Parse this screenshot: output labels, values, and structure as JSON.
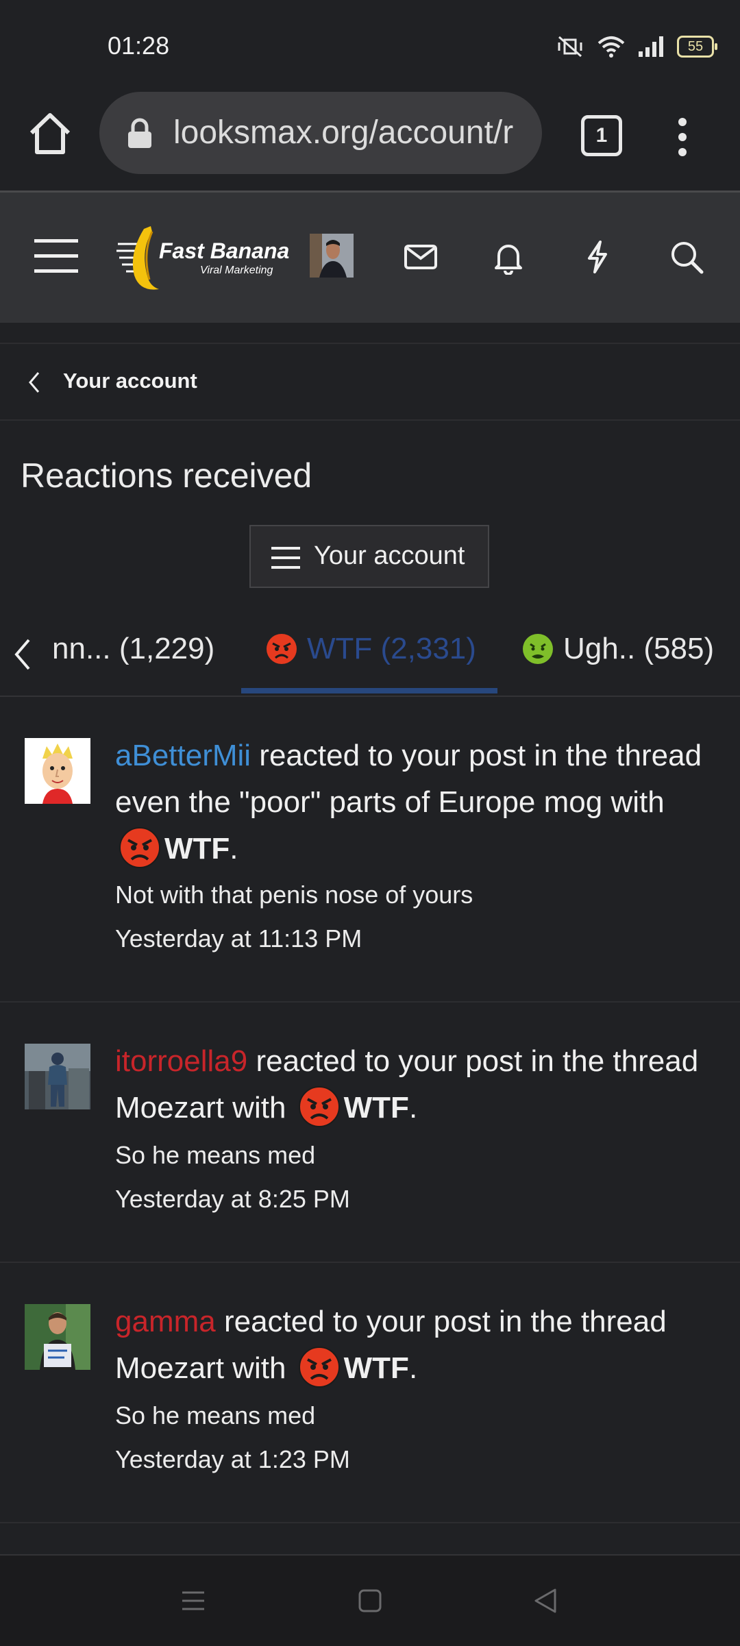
{
  "status_bar": {
    "time": "01:28",
    "battery": "55"
  },
  "browser": {
    "url": "looksmax.org/account/r",
    "tab_count": "1"
  },
  "site": {
    "logo_title": "Fast Banana",
    "logo_subtitle": "Viral Marketing"
  },
  "breadcrumb": {
    "label": "Your account"
  },
  "page": {
    "title": "Reactions received",
    "account_menu_label": "Your account"
  },
  "tabs": {
    "prev_label": "nn... (1,229)",
    "active_label": "WTF (2,331)",
    "next_label": "Ugh.. (585)"
  },
  "reactions": [
    {
      "username": "aBetterMii",
      "text_before": " reacted to your post in the thread even the \"poor\" parts of Europe mog with ",
      "reaction": "WTF",
      "snippet": "Not with that penis nose of yours",
      "time": "Yesterday at 11:13 PM"
    },
    {
      "username": "itorroella9",
      "text_before": " reacted to your post in the thread Moezart with ",
      "reaction": "WTF",
      "snippet": "So he means med",
      "time": "Yesterday at 8:25 PM"
    },
    {
      "username": "gamma",
      "text_before": " reacted to your post in the thread Moezart with ",
      "reaction": "WTF",
      "snippet": "So he means med",
      "time": "Yesterday at 1:23 PM"
    }
  ],
  "colors": {
    "background": "#202124",
    "header": "#323336",
    "username_blue": "#3f8fd6",
    "username_red": "#c8252a",
    "active_tab": "#27477d"
  }
}
